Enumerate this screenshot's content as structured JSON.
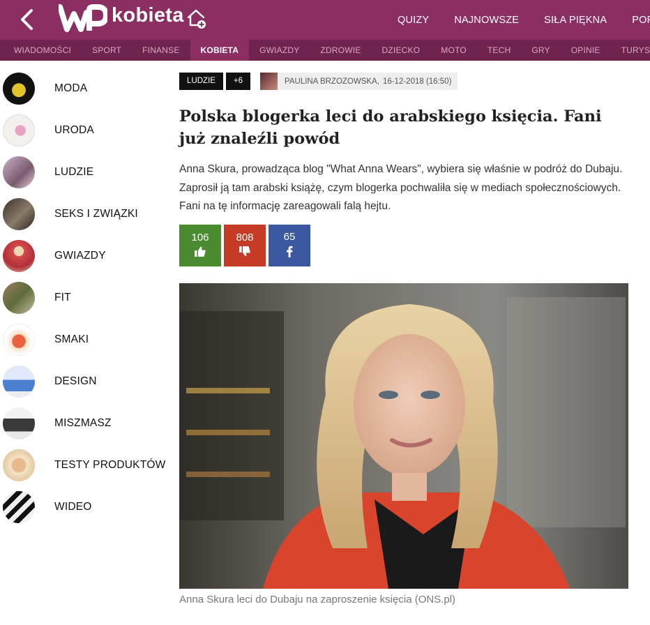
{
  "header": {
    "logo_text": "kobieta",
    "nav": [
      "QUIZY",
      "NAJNOWSZE",
      "SIŁA PIĘKNA",
      "POPU"
    ]
  },
  "categories": {
    "items": [
      "WIADOMOŚCI",
      "SPORT",
      "FINANSE",
      "KOBIETA",
      "GWIAZDY",
      "ZDROWIE",
      "DZIECKO",
      "MOTO",
      "TECH",
      "GRY",
      "OPINIE",
      "TURYSTYKA"
    ],
    "active": "KOBIETA"
  },
  "sidebar": {
    "items": [
      {
        "label": "MODA"
      },
      {
        "label": "URODA"
      },
      {
        "label": "LUDZIE"
      },
      {
        "label": "SEKS I ZWIĄZKI"
      },
      {
        "label": "GWIAZDY"
      },
      {
        "label": "FIT"
      },
      {
        "label": "SMAKI"
      },
      {
        "label": "DESIGN"
      },
      {
        "label": "MISZMASZ"
      },
      {
        "label": "TESTY PRODUKTÓW"
      },
      {
        "label": "WIDEO"
      }
    ]
  },
  "article": {
    "tag": "LUDZIE",
    "tag_more": "+6",
    "author": "PAULINA BRZOZOWSKA,",
    "date": "16-12-2018 (16:50)",
    "title": "Polska blogerka leci do arabskiego księcia. Fani już znaleźli powód",
    "lead": "Anna Skura, prowadząca blog \"What Anna Wears\", wybiera się właśnie w podróż do Dubaju. Zaprosił ją tam arabski książę, czym blogerka pochwaliła się w mediach społecznościowych. Fani na tę informację zareagowali falą hejtu.",
    "votes": {
      "likes": "106",
      "dislikes": "808",
      "facebook": "65"
    },
    "caption": "Anna Skura leci do Dubaju na zaproszenie księcia (ONS.pl)"
  },
  "colors": {
    "brand": "#8b2f63",
    "brand_dark": "#71234f",
    "like": "#4a8b2f",
    "dislike": "#c63b25",
    "facebook": "#3b58a0"
  }
}
